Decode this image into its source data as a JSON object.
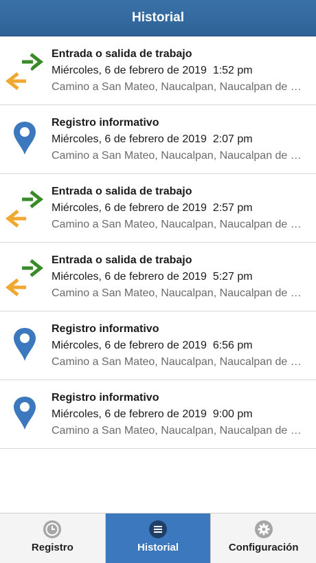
{
  "header": {
    "title": "Historial"
  },
  "items": [
    {
      "type": "work",
      "icon": "arrows-in-out-icon",
      "title": "Entrada o salida de trabajo",
      "date": "Miércoles, 6 de febrero de 2019",
      "time": "1:52 pm",
      "address": "Camino a San Mateo, Naucalpan, Naucalpan de Juárez"
    },
    {
      "type": "info",
      "icon": "map-pin-icon",
      "title": "Registro informativo",
      "date": "Miércoles, 6 de febrero de 2019",
      "time": "2:07 pm",
      "address": "Camino a San Mateo, Naucalpan, Naucalpan de Juárez"
    },
    {
      "type": "work",
      "icon": "arrows-in-out-icon",
      "title": "Entrada o salida de trabajo",
      "date": "Miércoles, 6 de febrero de 2019",
      "time": "2:57 pm",
      "address": "Camino a San Mateo, Naucalpan, Naucalpan de Juárez"
    },
    {
      "type": "work",
      "icon": "arrows-in-out-icon",
      "title": "Entrada o salida de trabajo",
      "date": "Miércoles, 6 de febrero de 2019",
      "time": "5:27 pm",
      "address": "Camino a San Mateo, Naucalpan, Naucalpan de Juárez"
    },
    {
      "type": "info",
      "icon": "map-pin-icon",
      "title": "Registro informativo",
      "date": "Miércoles, 6 de febrero de 2019",
      "time": "6:56 pm",
      "address": "Camino a San Mateo, Naucalpan, Naucalpan de Juárez"
    },
    {
      "type": "info",
      "icon": "map-pin-icon",
      "title": "Registro informativo",
      "date": "Miércoles, 6 de febrero de 2019",
      "time": "9:00 pm",
      "address": "Camino a San Mateo, Naucalpan, Naucalpan de Juárez"
    }
  ],
  "tabs": [
    {
      "label": "Registro",
      "icon": "clock-icon",
      "active": false
    },
    {
      "label": "Historial",
      "icon": "list-icon",
      "active": true
    },
    {
      "label": "Configuración",
      "icon": "gear-icon",
      "active": false
    }
  ],
  "colors": {
    "header": "#2e6296",
    "arrow_green": "#3a8a2a",
    "arrow_orange": "#f0a830",
    "pin_blue": "#3b78bd",
    "tab_active": "#3b78bd"
  }
}
